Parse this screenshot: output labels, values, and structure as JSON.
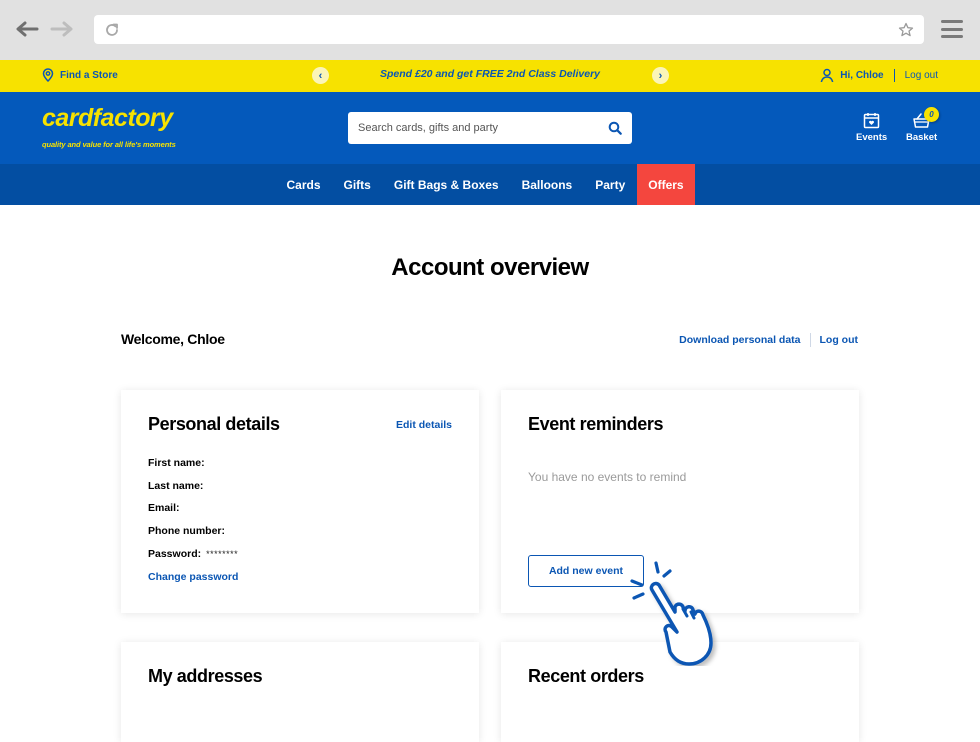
{
  "browser": {
    "back_icon": "arrow-left-icon",
    "forward_icon": "arrow-right-icon",
    "reload_icon": "reload-icon",
    "bookmark_icon": "star-icon",
    "menu_icon": "hamburger-menu-icon",
    "url": ""
  },
  "promo_bar": {
    "find_store": "Find a Store",
    "message": "Spend £20 and get FREE 2nd Class Delivery",
    "prev_arrow": "‹",
    "next_arrow": "›",
    "greeting": "Hi, Chloe",
    "logout": "Log out"
  },
  "header": {
    "logo_text": "cardfactory",
    "tagline": "quality and value for all life's moments",
    "search_placeholder": "Search cards, gifts and party",
    "events_label": "Events",
    "basket_label": "Basket",
    "basket_count": "0"
  },
  "nav": {
    "items": [
      {
        "label": "Cards"
      },
      {
        "label": "Gifts"
      },
      {
        "label": "Gift Bags & Boxes"
      },
      {
        "label": "Balloons"
      },
      {
        "label": "Party"
      },
      {
        "label": "Offers"
      }
    ]
  },
  "page": {
    "title": "Account overview",
    "welcome": "Welcome, Chloe",
    "download_data": "Download personal data",
    "logout": "Log out"
  },
  "personal_details": {
    "title": "Personal details",
    "edit_link": "Edit details",
    "fields": [
      {
        "label": "First name:",
        "value": ""
      },
      {
        "label": "Last name:",
        "value": ""
      },
      {
        "label": "Email:",
        "value": ""
      },
      {
        "label": "Phone number:",
        "value": ""
      },
      {
        "label": "Password:",
        "value": "********"
      }
    ],
    "change_password": "Change password"
  },
  "event_reminders": {
    "title": "Event reminders",
    "empty_message": "You have no events to remind",
    "add_button": "Add new event"
  },
  "addresses": {
    "title": "My addresses"
  },
  "recent_orders": {
    "title": "Recent orders"
  },
  "colors": {
    "brand_blue": "#0459bb",
    "nav_blue": "#034ea2",
    "brand_yellow": "#f7e200",
    "offers_red": "#f4463e",
    "link_blue": "#0b56b3"
  }
}
